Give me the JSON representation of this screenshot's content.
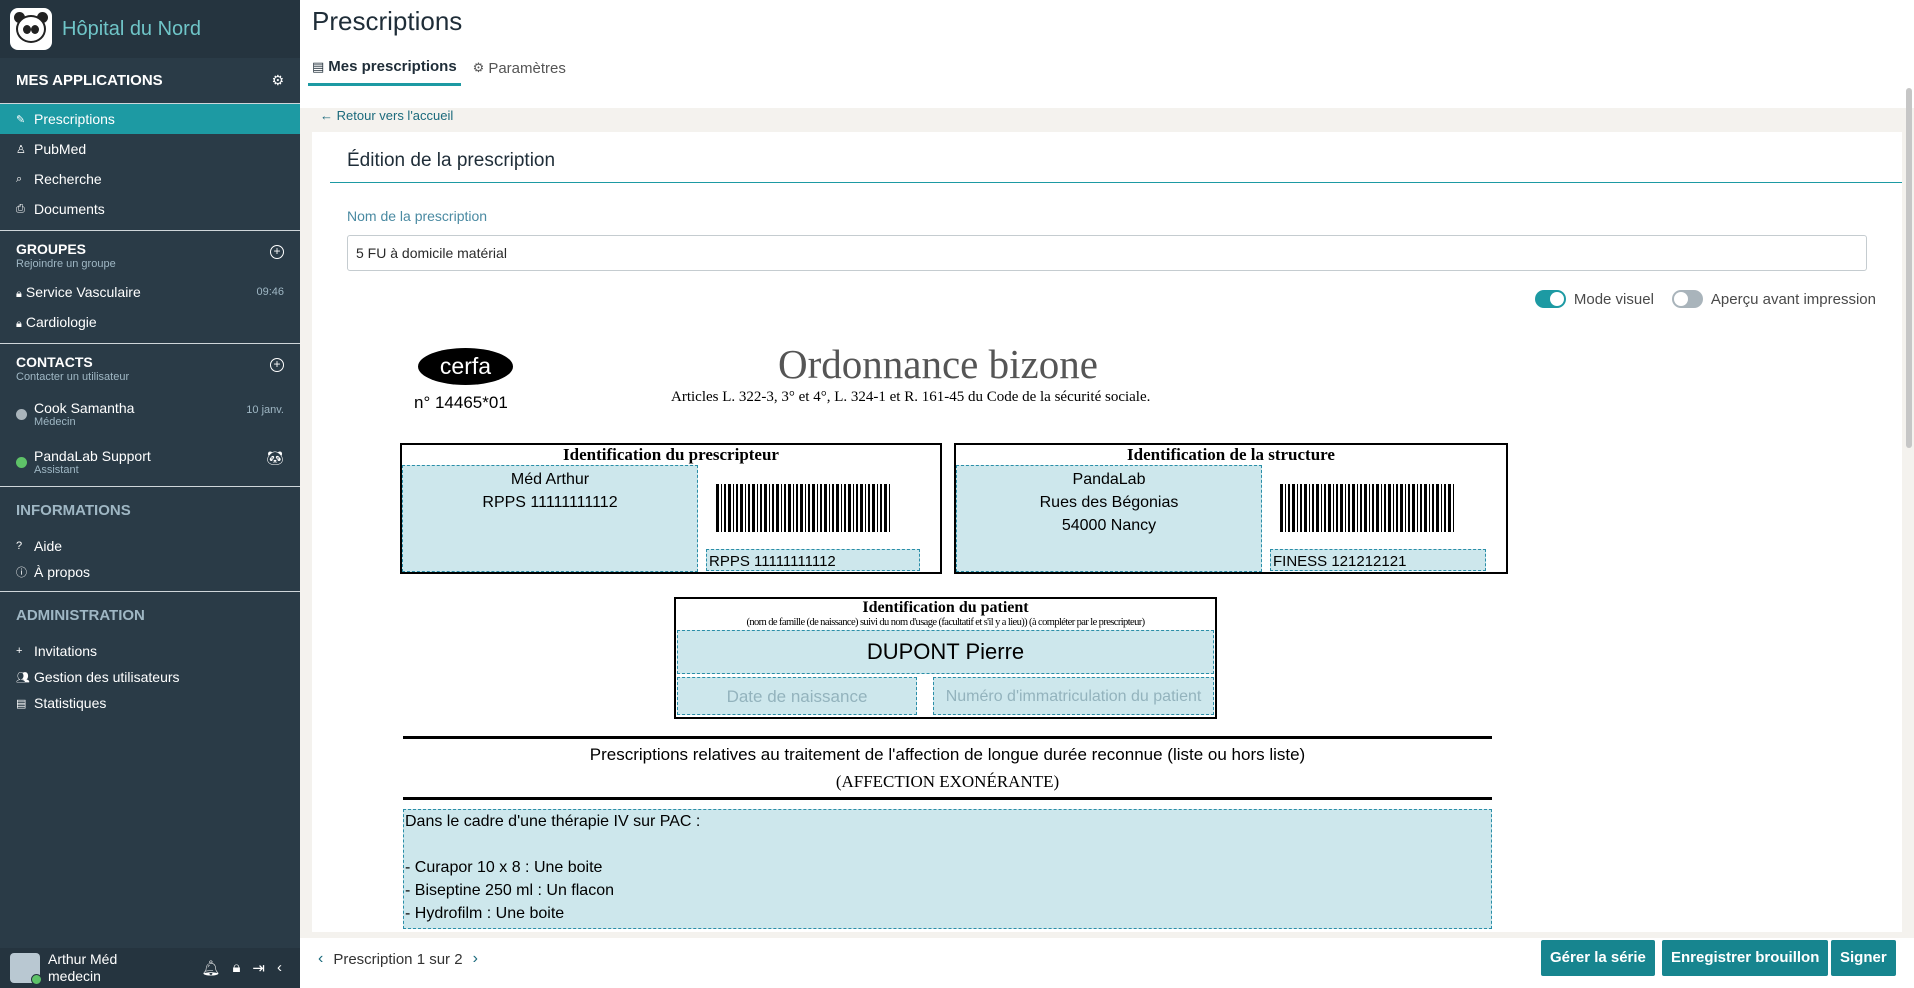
{
  "app": {
    "name": "Hôpital du Nord"
  },
  "sidebar": {
    "apps_title": "MES APPLICATIONS",
    "apps": [
      {
        "label": "Prescriptions",
        "icon": "prescription-icon",
        "active": true
      },
      {
        "label": "PubMed",
        "icon": "pubmed-icon"
      },
      {
        "label": "Recherche",
        "icon": "search-icon"
      },
      {
        "label": "Documents",
        "icon": "paperclip-icon"
      }
    ],
    "groups": {
      "title": "GROUPES",
      "subtitle": "Rejoindre un groupe",
      "items": [
        {
          "label": "Service Vasculaire",
          "time": "09:46"
        },
        {
          "label": "Cardiologie",
          "time": ""
        }
      ]
    },
    "contacts": {
      "title": "CONTACTS",
      "subtitle": "Contacter un utilisateur",
      "items": [
        {
          "name": "Cook Samantha",
          "role": "Médecin",
          "meta": "10 janv.",
          "status_color": "#a9b4bb"
        },
        {
          "name": "PandaLab Support",
          "role": "Assistant",
          "meta": "",
          "status_color": "#5ec268"
        }
      ]
    },
    "informations": {
      "title": "INFORMATIONS",
      "items": [
        {
          "label": "Aide",
          "icon": "help-icon"
        },
        {
          "label": "À propos",
          "icon": "info-icon"
        }
      ]
    },
    "administration": {
      "title": "ADMINISTRATION",
      "items": [
        {
          "label": "Invitations",
          "icon": "plus-icon"
        },
        {
          "label": "Gestion des utilisateurs",
          "icon": "users-icon"
        },
        {
          "label": "Statistiques",
          "icon": "stats-icon"
        }
      ]
    },
    "user": {
      "name": "Arthur Méd",
      "role": "medecin"
    }
  },
  "header": {
    "title": "Prescriptions",
    "tabs": [
      {
        "label": "Mes prescriptions",
        "active": true
      },
      {
        "label": "Paramètres",
        "active": false
      }
    ],
    "back_link": "Retour vers l'accueil"
  },
  "editor": {
    "section_title": "Édition de la prescription",
    "name_label": "Nom de la prescription",
    "name_value": "5 FU à domicile matérial",
    "toggles": {
      "visual_mode": "Mode visuel",
      "print_preview": "Aperçu avant impression"
    }
  },
  "form": {
    "badge": "cerfa",
    "number": "n° 14465*01",
    "title": "Ordonnance bizone",
    "subtitle": "Articles L. 322-3, 3° et 4°, L. 324-1 et R. 161-45 du Code de la sécurité sociale.",
    "prescriber": {
      "title": "Identification du prescripteur",
      "name": "Méd Arthur",
      "rpps": "RPPS 11111111112",
      "barcode_text": "RPPS 11111111112"
    },
    "structure": {
      "title": "Identification de la structure",
      "name": "PandaLab",
      "street": "Rues des Bégonias",
      "city": "54000 Nancy",
      "barcode_text": "FINESS 121212121"
    },
    "patient": {
      "title": "Identification du patient",
      "subtitle": "(nom de famille (de naissance) suivi du nom d'usage (facultatif et s'il y a lieu)) (à compléter par le prescripteur)",
      "name": "DUPONT Pierre",
      "dob_placeholder": "Date de naissance",
      "ssn_placeholder": "Numéro d'immatriculation du patient"
    },
    "ald": {
      "title": "Prescriptions relatives au traitement de l'affection de longue durée reconnue (liste ou hors liste)",
      "subtitle": "(AFFECTION EXONÉRANTE)",
      "lines": [
        "Dans le cadre d'une thérapie IV sur PAC :",
        "",
        "- Curapor 10 x 8 : Une boite",
        "- Biseptine 250 ml : Un flacon",
        "- Hydrofilm : Une boite"
      ]
    }
  },
  "footer": {
    "pager": "Prescription 1 sur 2",
    "buttons": {
      "manage": "Gérer la série",
      "save": "Enregistrer brouillon",
      "sign": "Signer"
    }
  },
  "colors": {
    "accent": "#1d9aa3",
    "sidebar": "#2a3b47",
    "fill": "#cde7ec"
  }
}
